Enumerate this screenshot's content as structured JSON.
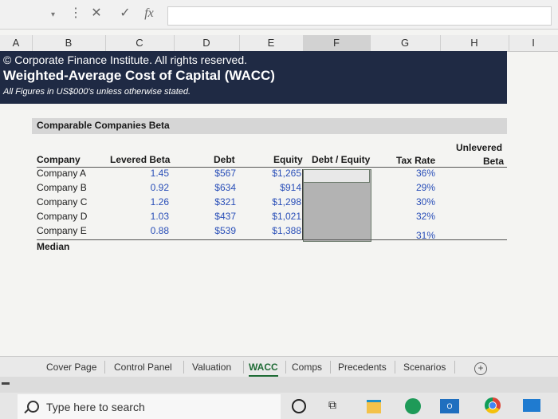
{
  "formula_bar": {
    "cancel_symbol": "✕",
    "enter_symbol": "✓",
    "fx_symbol": "fx",
    "value": ""
  },
  "columns": [
    "A",
    "B",
    "C",
    "D",
    "E",
    "F",
    "G",
    "H",
    "I"
  ],
  "title_band": {
    "copyright": "© Corporate Finance Institute. All rights reserved.",
    "title": "Weighted-Average Cost of Capital (WACC)",
    "subtitle": "All Figures in US$000's unless otherwise stated."
  },
  "section": {
    "title": "Comparable Companies Beta"
  },
  "table": {
    "headers": {
      "company": "Company",
      "levered_beta": "Levered Beta",
      "debt": "Debt",
      "equity": "Equity",
      "debt_equity": "Debt / Equity",
      "tax_rate": "Tax Rate",
      "unlevered_line1": "Unlevered",
      "unlevered_line2": "Beta"
    },
    "rows": [
      {
        "company": "Company A",
        "levered_beta": "1.45",
        "debt": "$567",
        "equity": "$1,265",
        "tax_rate": "36%"
      },
      {
        "company": "Company B",
        "levered_beta": "0.92",
        "debt": "$634",
        "equity": "$914",
        "tax_rate": "29%"
      },
      {
        "company": "Company C",
        "levered_beta": "1.26",
        "debt": "$321",
        "equity": "$1,298",
        "tax_rate": "30%"
      },
      {
        "company": "Company D",
        "levered_beta": "1.03",
        "debt": "$437",
        "equity": "$1,021",
        "tax_rate": "32%"
      },
      {
        "company": "Company E",
        "levered_beta": "0.88",
        "debt": "$539",
        "equity": "$1,388",
        "tax_rate": "31%"
      }
    ],
    "median_label": "Median"
  },
  "sheet_tabs": [
    "Cover Page",
    "Control Panel",
    "Valuation",
    "WACC",
    "Comps",
    "Precedents",
    "Scenarios"
  ],
  "active_tab": "WACC",
  "add_sheet_symbol": "+",
  "taskbar": {
    "search_placeholder": "Type here to search",
    "mail_label": "O"
  },
  "colors": {
    "title_band": "#1f2a44",
    "input_blue": "#2a4fb8",
    "active_tab": "#1e6b35"
  }
}
